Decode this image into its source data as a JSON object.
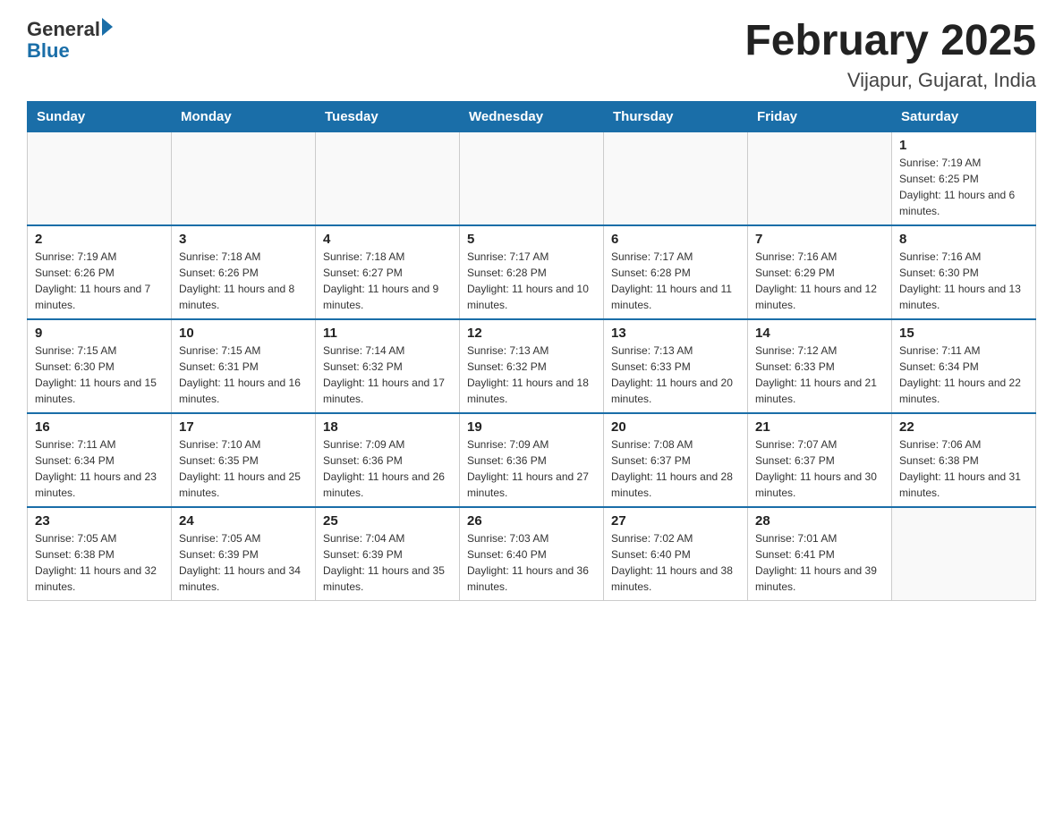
{
  "header": {
    "logo_general": "General",
    "logo_blue": "Blue",
    "title": "February 2025",
    "location": "Vijapur, Gujarat, India"
  },
  "days_of_week": [
    "Sunday",
    "Monday",
    "Tuesday",
    "Wednesday",
    "Thursday",
    "Friday",
    "Saturday"
  ],
  "weeks": [
    {
      "days": [
        {
          "number": "",
          "info": ""
        },
        {
          "number": "",
          "info": ""
        },
        {
          "number": "",
          "info": ""
        },
        {
          "number": "",
          "info": ""
        },
        {
          "number": "",
          "info": ""
        },
        {
          "number": "",
          "info": ""
        },
        {
          "number": "1",
          "info": "Sunrise: 7:19 AM\nSunset: 6:25 PM\nDaylight: 11 hours and 6 minutes."
        }
      ]
    },
    {
      "days": [
        {
          "number": "2",
          "info": "Sunrise: 7:19 AM\nSunset: 6:26 PM\nDaylight: 11 hours and 7 minutes."
        },
        {
          "number": "3",
          "info": "Sunrise: 7:18 AM\nSunset: 6:26 PM\nDaylight: 11 hours and 8 minutes."
        },
        {
          "number": "4",
          "info": "Sunrise: 7:18 AM\nSunset: 6:27 PM\nDaylight: 11 hours and 9 minutes."
        },
        {
          "number": "5",
          "info": "Sunrise: 7:17 AM\nSunset: 6:28 PM\nDaylight: 11 hours and 10 minutes."
        },
        {
          "number": "6",
          "info": "Sunrise: 7:17 AM\nSunset: 6:28 PM\nDaylight: 11 hours and 11 minutes."
        },
        {
          "number": "7",
          "info": "Sunrise: 7:16 AM\nSunset: 6:29 PM\nDaylight: 11 hours and 12 minutes."
        },
        {
          "number": "8",
          "info": "Sunrise: 7:16 AM\nSunset: 6:30 PM\nDaylight: 11 hours and 13 minutes."
        }
      ]
    },
    {
      "days": [
        {
          "number": "9",
          "info": "Sunrise: 7:15 AM\nSunset: 6:30 PM\nDaylight: 11 hours and 15 minutes."
        },
        {
          "number": "10",
          "info": "Sunrise: 7:15 AM\nSunset: 6:31 PM\nDaylight: 11 hours and 16 minutes."
        },
        {
          "number": "11",
          "info": "Sunrise: 7:14 AM\nSunset: 6:32 PM\nDaylight: 11 hours and 17 minutes."
        },
        {
          "number": "12",
          "info": "Sunrise: 7:13 AM\nSunset: 6:32 PM\nDaylight: 11 hours and 18 minutes."
        },
        {
          "number": "13",
          "info": "Sunrise: 7:13 AM\nSunset: 6:33 PM\nDaylight: 11 hours and 20 minutes."
        },
        {
          "number": "14",
          "info": "Sunrise: 7:12 AM\nSunset: 6:33 PM\nDaylight: 11 hours and 21 minutes."
        },
        {
          "number": "15",
          "info": "Sunrise: 7:11 AM\nSunset: 6:34 PM\nDaylight: 11 hours and 22 minutes."
        }
      ]
    },
    {
      "days": [
        {
          "number": "16",
          "info": "Sunrise: 7:11 AM\nSunset: 6:34 PM\nDaylight: 11 hours and 23 minutes."
        },
        {
          "number": "17",
          "info": "Sunrise: 7:10 AM\nSunset: 6:35 PM\nDaylight: 11 hours and 25 minutes."
        },
        {
          "number": "18",
          "info": "Sunrise: 7:09 AM\nSunset: 6:36 PM\nDaylight: 11 hours and 26 minutes."
        },
        {
          "number": "19",
          "info": "Sunrise: 7:09 AM\nSunset: 6:36 PM\nDaylight: 11 hours and 27 minutes."
        },
        {
          "number": "20",
          "info": "Sunrise: 7:08 AM\nSunset: 6:37 PM\nDaylight: 11 hours and 28 minutes."
        },
        {
          "number": "21",
          "info": "Sunrise: 7:07 AM\nSunset: 6:37 PM\nDaylight: 11 hours and 30 minutes."
        },
        {
          "number": "22",
          "info": "Sunrise: 7:06 AM\nSunset: 6:38 PM\nDaylight: 11 hours and 31 minutes."
        }
      ]
    },
    {
      "days": [
        {
          "number": "23",
          "info": "Sunrise: 7:05 AM\nSunset: 6:38 PM\nDaylight: 11 hours and 32 minutes."
        },
        {
          "number": "24",
          "info": "Sunrise: 7:05 AM\nSunset: 6:39 PM\nDaylight: 11 hours and 34 minutes."
        },
        {
          "number": "25",
          "info": "Sunrise: 7:04 AM\nSunset: 6:39 PM\nDaylight: 11 hours and 35 minutes."
        },
        {
          "number": "26",
          "info": "Sunrise: 7:03 AM\nSunset: 6:40 PM\nDaylight: 11 hours and 36 minutes."
        },
        {
          "number": "27",
          "info": "Sunrise: 7:02 AM\nSunset: 6:40 PM\nDaylight: 11 hours and 38 minutes."
        },
        {
          "number": "28",
          "info": "Sunrise: 7:01 AM\nSunset: 6:41 PM\nDaylight: 11 hours and 39 minutes."
        },
        {
          "number": "",
          "info": ""
        }
      ]
    }
  ]
}
